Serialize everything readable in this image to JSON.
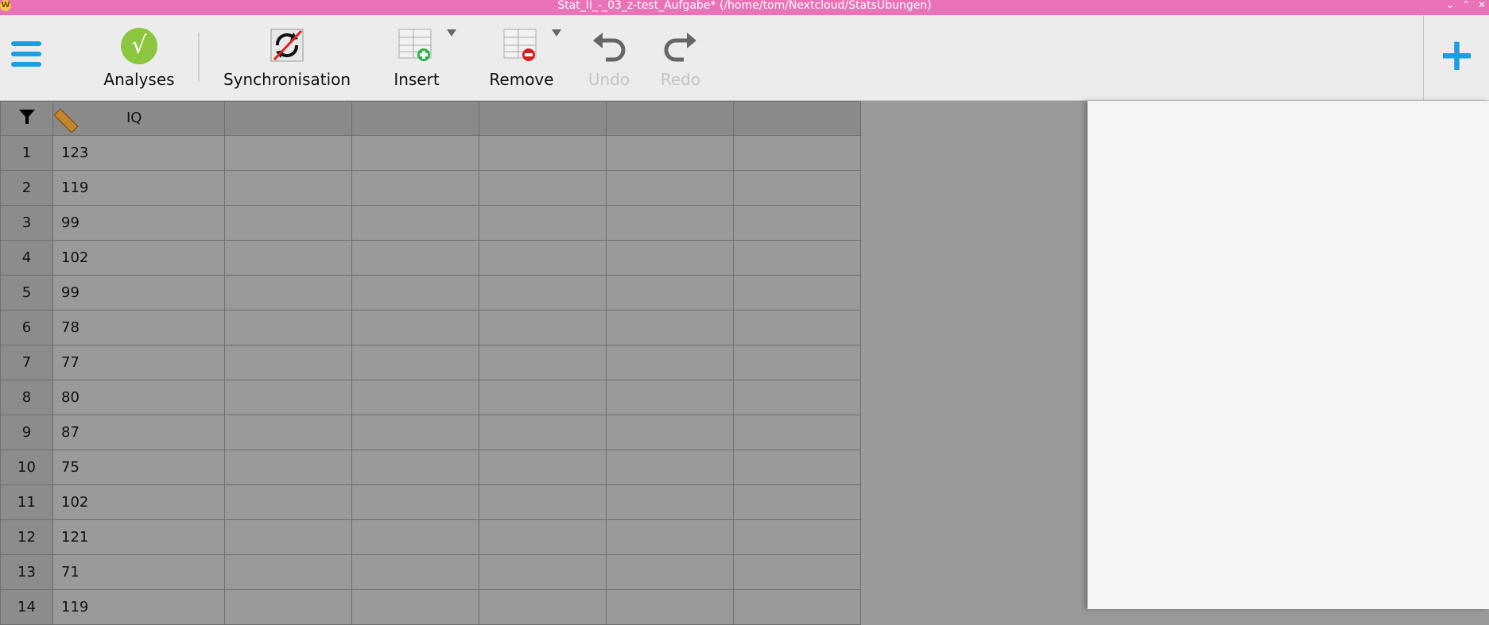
{
  "window": {
    "title": "Stat_II_-_03_z-test_Aufgabe* (/home/tom/Nextcloud/StatsUbungen)",
    "app_icon_letter": "W"
  },
  "toolbar": {
    "analyses_label": "Analyses",
    "synchronisation_label": "Synchronisation",
    "insert_label": "Insert",
    "remove_label": "Remove",
    "undo_label": "Undo",
    "redo_label": "Redo",
    "accent_color": "#1aa0de"
  },
  "grid": {
    "columns": [
      {
        "name": "IQ",
        "type_icon": "ruler-icon"
      }
    ],
    "rows": [
      {
        "n": "1",
        "iq": "123"
      },
      {
        "n": "2",
        "iq": "119"
      },
      {
        "n": "3",
        "iq": "99"
      },
      {
        "n": "4",
        "iq": "102"
      },
      {
        "n": "5",
        "iq": "99"
      },
      {
        "n": "6",
        "iq": "78"
      },
      {
        "n": "7",
        "iq": "77"
      },
      {
        "n": "8",
        "iq": "80"
      },
      {
        "n": "9",
        "iq": "87"
      },
      {
        "n": "10",
        "iq": "75"
      },
      {
        "n": "11",
        "iq": "102"
      },
      {
        "n": "12",
        "iq": "121"
      },
      {
        "n": "13",
        "iq": "71"
      },
      {
        "n": "14",
        "iq": "119"
      }
    ]
  }
}
